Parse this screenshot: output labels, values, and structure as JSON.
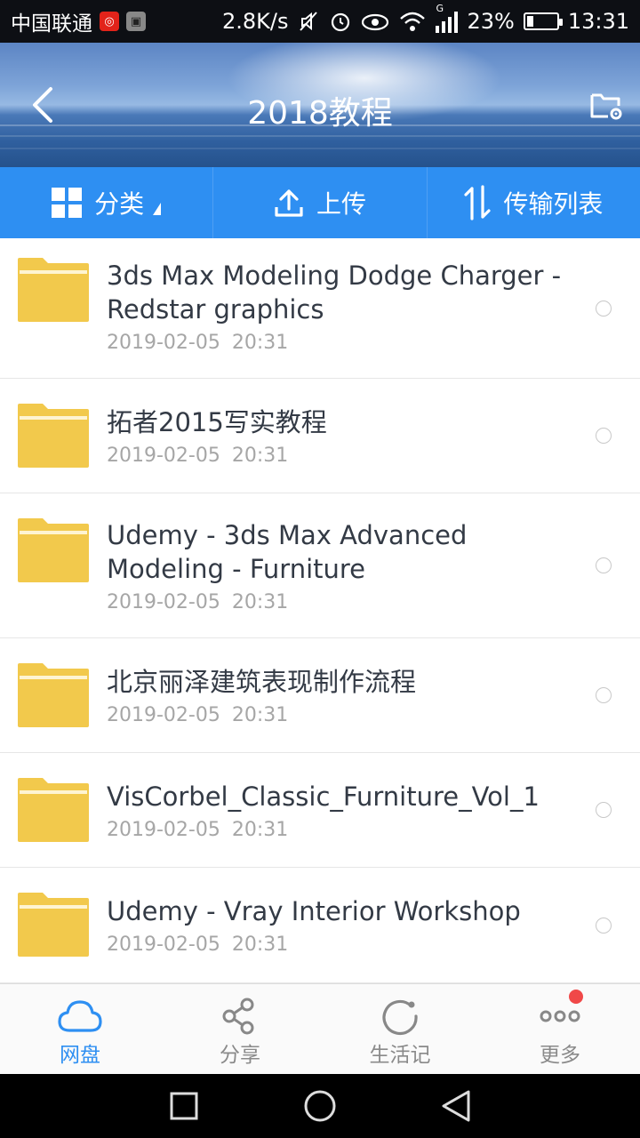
{
  "status_bar": {
    "carrier": "中国联通",
    "net_speed": "2.8K/s",
    "network_type": "G",
    "battery": "23%",
    "battery_level": 0.23,
    "time": "13:31"
  },
  "header": {
    "title": "2018教程",
    "back_icon": "chevron-left-icon",
    "settings_icon": "folder-settings-icon"
  },
  "toolbar": {
    "category_label": "分类",
    "upload_label": "上传",
    "transfer_label": "传输列表"
  },
  "files": [
    {
      "name": "3ds Max Modeling Dodge Charger - Redstar graphics",
      "date": "2019-02-05  20:31"
    },
    {
      "name": "拓者2015写实教程",
      "date": "2019-02-05  20:31"
    },
    {
      "name": "Udemy - 3ds Max Advanced Modeling - Furniture",
      "date": "2019-02-05  20:31"
    },
    {
      "name": "北京丽泽建筑表现制作流程",
      "date": "2019-02-05  20:31"
    },
    {
      "name": "VisCorbel_Classic_Furniture_Vol_1",
      "date": "2019-02-05  20:31"
    },
    {
      "name": "Udemy - Vray Interior Workshop",
      "date": "2019-02-05  20:31"
    }
  ],
  "bottom_nav": {
    "disk_label": "网盘",
    "share_label": "分享",
    "life_label": "生活记",
    "more_label": "更多"
  },
  "colors": {
    "accent": "#2e8ff2",
    "folder": "#f2c94c",
    "notification_dot": "#f04848"
  }
}
